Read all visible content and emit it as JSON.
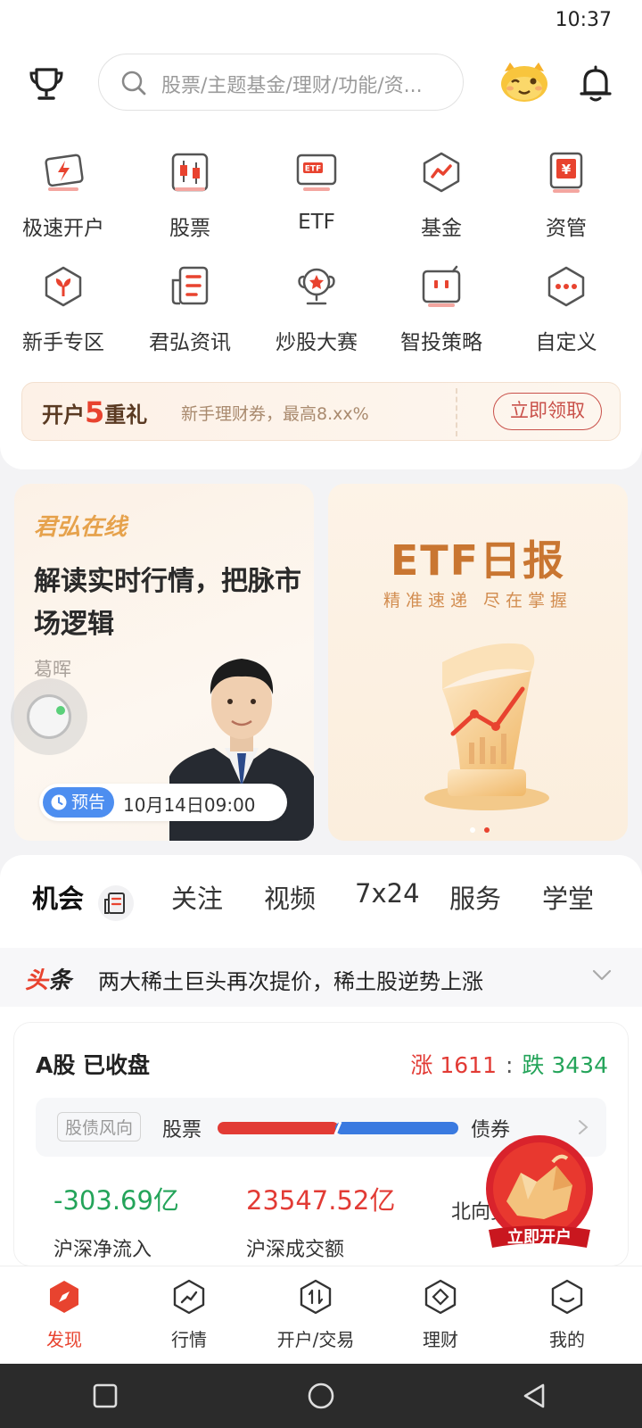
{
  "status_bar": {
    "time": "10:37"
  },
  "header": {
    "search_placeholder": "股票/主题基金/理财/功能/资..."
  },
  "menu": [
    {
      "label": "极速开户",
      "icon": "fast-account-icon"
    },
    {
      "label": "股票",
      "icon": "stock-candle-icon"
    },
    {
      "label": "ETF",
      "icon": "etf-icon"
    },
    {
      "label": "基金",
      "icon": "fund-icon"
    },
    {
      "label": "资管",
      "icon": "asset-management-icon"
    },
    {
      "label": "新手专区",
      "icon": "newbie-icon"
    },
    {
      "label": "君弘资讯",
      "icon": "news-icon"
    },
    {
      "label": "炒股大赛",
      "icon": "contest-trophy-icon"
    },
    {
      "label": "智投策略",
      "icon": "strategy-icon"
    },
    {
      "label": "自定义",
      "icon": "customize-icon"
    }
  ],
  "promo": {
    "title_prefix": "开户",
    "title_num": "5",
    "title_suffix": "重礼",
    "desc": "新手理财券，最高8.xx%",
    "button": "立即领取"
  },
  "live": {
    "brand": "君弘在线",
    "headline": "解读实时行情，把脉市场逻辑",
    "author": "葛晖",
    "tag": "预告",
    "time": "10月14日09:00"
  },
  "etf_banner": {
    "title": "ETF日报",
    "subtitle": "精准速递 尽在掌握"
  },
  "tabs": [
    {
      "label": "机会",
      "active": true
    },
    {
      "label": "关注",
      "active": false
    },
    {
      "label": "视频",
      "active": false
    },
    {
      "label": "7x24",
      "active": false
    },
    {
      "label": "服务",
      "active": false
    },
    {
      "label": "学堂",
      "active": false
    }
  ],
  "headline": {
    "logo_red": "头",
    "logo_black": "条",
    "text": "两大稀土巨头再次提价，稀土股逆势上涨"
  },
  "market": {
    "title": "A股 已收盘",
    "up_label": "涨 1611",
    "separator": ":",
    "down_label": "跌 3434",
    "wind_tag": "股债风向",
    "wind_left": "股票",
    "wind_right": "债券",
    "stock_share": 0.49,
    "stats": [
      {
        "value": "-303.69亿",
        "label": "沪深净流入",
        "tone": "down"
      },
      {
        "value": "23547.52亿",
        "label": "沪深成交额",
        "tone": "up"
      },
      {
        "value": "",
        "label": "北向资金流入",
        "tone": "neutral"
      }
    ]
  },
  "open_badge": {
    "label": "立即开户"
  },
  "bottom_nav": [
    {
      "label": "发现",
      "icon": "discover-icon",
      "active": true
    },
    {
      "label": "行情",
      "icon": "market-icon",
      "active": false
    },
    {
      "label": "开户/交易",
      "icon": "trade-icon",
      "active": false
    },
    {
      "label": "理财",
      "icon": "wealth-icon",
      "active": false
    },
    {
      "label": "我的",
      "icon": "profile-icon",
      "active": false
    }
  ],
  "colors": {
    "accent_red": "#e8432f",
    "up_red": "#e23b35",
    "down_green": "#24a45a",
    "bond_blue": "#3a7ae0",
    "etf_gold": "#c97631"
  }
}
